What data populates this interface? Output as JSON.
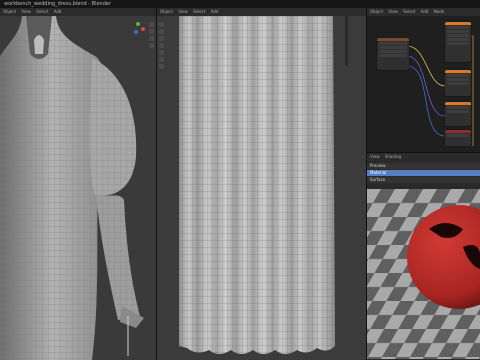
{
  "window": {
    "title": "workbench_wedding_dress.blend - Blender"
  },
  "left_viewport": {
    "header_items": [
      "Object",
      "View",
      "Select",
      "Add"
    ]
  },
  "middle_viewport": {
    "header_items": [
      "Object",
      "View",
      "Select",
      "Add"
    ]
  },
  "node_editor": {
    "header_items": [
      "Object",
      "View",
      "Select",
      "Add",
      "Node"
    ]
  },
  "material_preview": {
    "header_items": [
      "View",
      "Shading"
    ],
    "property_rows": [
      "Preview",
      "Material",
      "Surface"
    ]
  },
  "colors": {
    "accent_blue": "#5680c2",
    "material_red": "#c92f2b",
    "node_orange": "#d87a28",
    "wire_yellow": "#d6c445",
    "wire_purple": "#7a5cc7",
    "wire_blue": "#3d6fc7"
  }
}
